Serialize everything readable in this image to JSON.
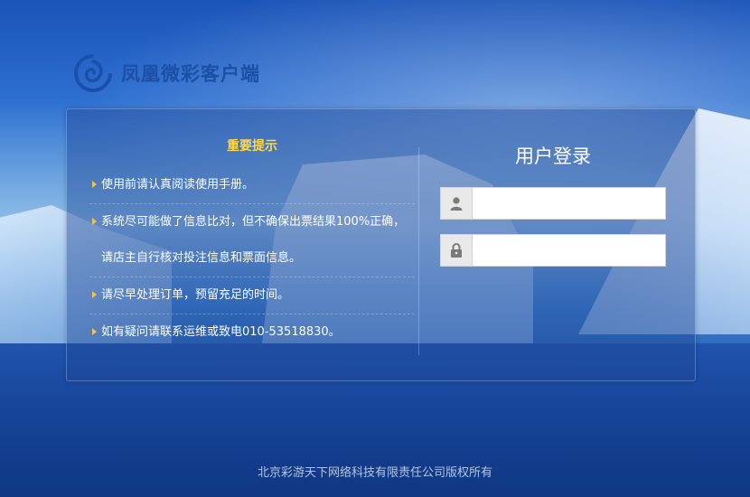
{
  "brand": {
    "name": "凤凰微彩客户端"
  },
  "notice": {
    "title": "重要提示",
    "items": [
      {
        "line1": "使用前请认真阅读使用手册。",
        "line2": ""
      },
      {
        "line1": "系统尽可能做了信息比对，但不确保出票结果100%正确，",
        "line2": "请店主自行核对投注信息和票面信息。"
      },
      {
        "line1": "请尽早处理订单，预留充足的时间。",
        "line2": ""
      },
      {
        "line1": "如有疑问请联系运维或致电010-53518830。",
        "line2": ""
      }
    ]
  },
  "login": {
    "title": "用户登录",
    "username": {
      "value": "",
      "icon": "user-icon"
    },
    "password": {
      "value": "",
      "icon": "lock-icon"
    }
  },
  "footer": {
    "copyright": "北京彩游天下网络科技有限责任公司版权所有"
  },
  "colors": {
    "accent_title": "#ffd94a",
    "bullet": "#f3c341",
    "brand": "#1c4fa6"
  }
}
